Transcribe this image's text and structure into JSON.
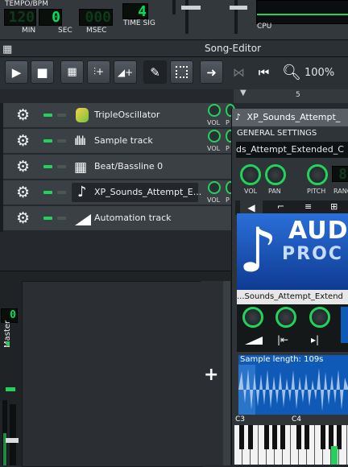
{
  "transport": {
    "tempo_label": "TEMPO/BPM",
    "tempo_display": "120",
    "min_display": "00",
    "min_label": "MIN",
    "sec_display": "0",
    "sec_label": "SEC",
    "msec_display": "000",
    "msec_label": "MSEC",
    "timesig_display": "4",
    "timesig_label": "TIME SIG",
    "cpu_label": "CPU"
  },
  "song_editor": {
    "title": "Song-Editor",
    "zoom": "100%",
    "ruler_mark": "5"
  },
  "tracks": [
    {
      "name": "TripleOscillator",
      "icon": "triple-oscillator-icon"
    },
    {
      "name": "Sample track",
      "icon": "waveform-icon"
    },
    {
      "name": "Beat/Bassline 0",
      "icon": "beat-grid-icon"
    },
    {
      "name": "XP_Sounds_Attempt_E...",
      "icon": "note-icon"
    },
    {
      "name": "Automation track",
      "icon": "automation-ramp-icon"
    }
  ],
  "knob_labels": {
    "vol": "VOL",
    "pan": "P"
  },
  "mixer": {
    "master_label": "Master",
    "add_button": "+",
    "lcd": "0"
  },
  "instrument": {
    "title": "XP_Sounds_Attempt_",
    "general_settings": "GENERAL SETTINGS",
    "name_field": "ds_Attempt_Extended_C",
    "vol_label": "VOL",
    "pan_label": "PAN",
    "pitch_label": "PITCH",
    "range_label": "RANG",
    "logo_line1": "AUDI",
    "logo_line2": "PROC",
    "sample_name": "...Sounds_Attempt_Extend",
    "sample_length": "Sample length: 109s",
    "key_c3": "C3",
    "key_c4": "C4"
  },
  "colors": {
    "accent": "#22d35b",
    "lcd_green": "#00e05a",
    "waveform_bg": "#0f5ab6"
  }
}
